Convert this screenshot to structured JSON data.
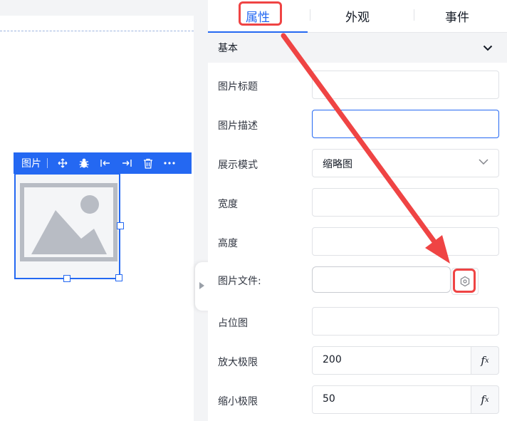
{
  "canvas": {
    "component_toolbar": {
      "title": "图片",
      "icons": [
        "move-icon",
        "bug-icon",
        "align-left-icon",
        "align-right-icon",
        "trash-icon",
        "more-icon"
      ]
    }
  },
  "panel": {
    "tabs": [
      {
        "label": "属性",
        "active": true
      },
      {
        "label": "外观",
        "active": false
      },
      {
        "label": "事件",
        "active": false
      }
    ],
    "section": {
      "title": "基本",
      "expanded": true
    },
    "fields": {
      "image_title": {
        "label": "图片标题",
        "value": ""
      },
      "image_desc": {
        "label": "图片描述",
        "value": ""
      },
      "display_mode": {
        "label": "展示模式",
        "value": "缩略图"
      },
      "width": {
        "label": "宽度",
        "value": ""
      },
      "height": {
        "label": "高度",
        "value": ""
      },
      "image_file": {
        "label": "图片文件:",
        "value": ""
      },
      "placeholder": {
        "label": "占位图",
        "value": ""
      },
      "zoom_max": {
        "label": "放大极限",
        "value": "200",
        "fx": "fx"
      },
      "zoom_min": {
        "label": "缩小极限",
        "value": "50",
        "fx": "fx"
      }
    }
  },
  "colors": {
    "accent": "#2468f2",
    "annotation": "#ef4444",
    "section_bg": "#f3f4f6"
  }
}
